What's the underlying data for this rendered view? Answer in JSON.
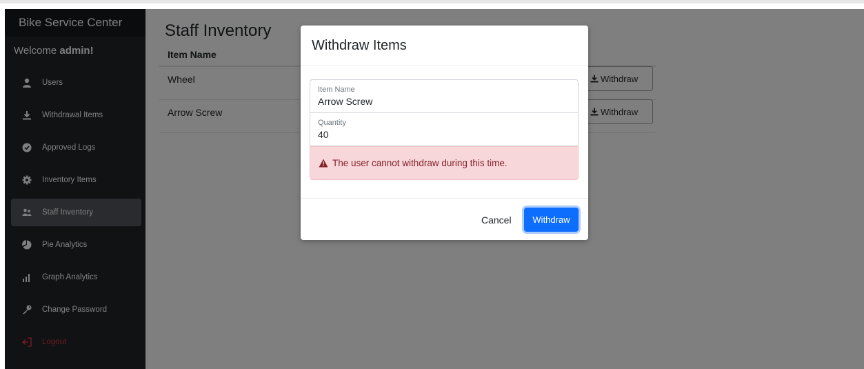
{
  "sidebar": {
    "brand": "Bike Service Center",
    "welcome_prefix": "Welcome ",
    "welcome_user": "admin!",
    "items": [
      {
        "label": "Users",
        "icon": "user-icon"
      },
      {
        "label": "Withdrawal Items",
        "icon": "download-icon"
      },
      {
        "label": "Approved Logs",
        "icon": "check-circle-icon"
      },
      {
        "label": "Inventory Items",
        "icon": "gear-icon"
      },
      {
        "label": "Staff Inventory",
        "icon": "users-icon",
        "active": true
      },
      {
        "label": "Pie Analytics",
        "icon": "pie-chart-icon"
      },
      {
        "label": "Graph Analytics",
        "icon": "bar-chart-icon"
      },
      {
        "label": "Change Password",
        "icon": "key-icon"
      },
      {
        "label": "Logout",
        "icon": "logout-icon",
        "color": "#dc3545"
      }
    ]
  },
  "main": {
    "title": "Staff Inventory",
    "table": {
      "headers": [
        "Item Name"
      ],
      "rows": [
        {
          "item_name": "Wheel",
          "action_label": "Withdraw"
        },
        {
          "item_name": "Arrow Screw",
          "action_label": "Withdraw"
        }
      ]
    }
  },
  "modal": {
    "title": "Withdraw Items",
    "item_name_label": "Item Name",
    "item_name_value": "Arrow Screw",
    "quantity_label": "Quantity",
    "quantity_value": "40",
    "alert_text": "The user cannot withdraw during this time.",
    "cancel_label": "Cancel",
    "withdraw_label": "Withdraw"
  },
  "colors": {
    "primary": "#0d6efd",
    "danger": "#dc3545",
    "alert_bg": "#f8d7da",
    "sidebar_bg": "#212529"
  }
}
